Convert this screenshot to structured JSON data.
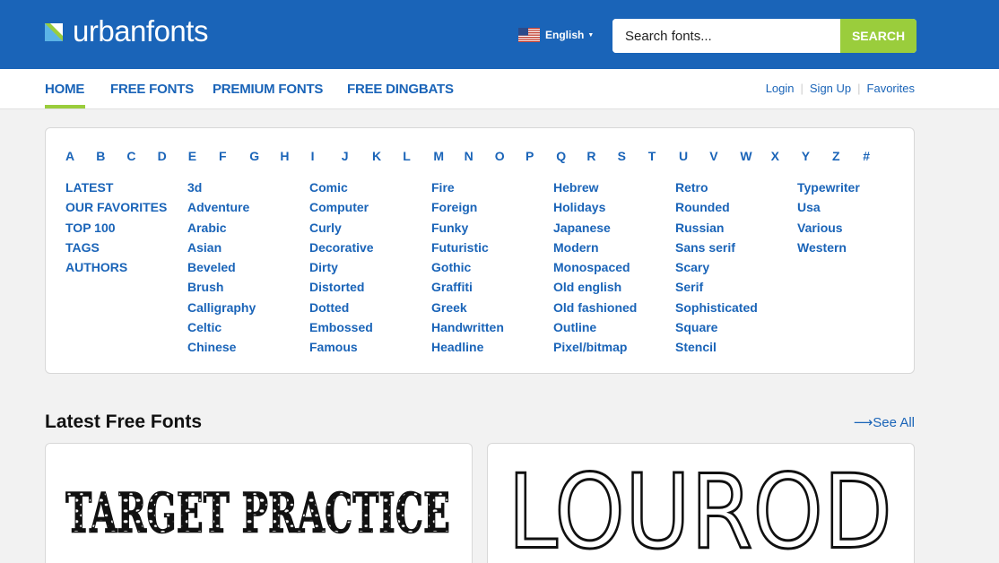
{
  "header": {
    "logo_text": "urbanfonts",
    "language": "English",
    "search": {
      "placeholder": "Search fonts...",
      "button_label": "SEARCH"
    },
    "brand_color": "#1a64b8",
    "accent_color": "#9acd3c"
  },
  "nav": {
    "items": [
      {
        "label": "HOME",
        "active": true
      },
      {
        "label": "FREE FONTS"
      },
      {
        "label": "PREMIUM FONTS"
      },
      {
        "label": "FREE DINGBATS"
      }
    ],
    "user_links": [
      "Login",
      "Sign Up",
      "Favorites"
    ]
  },
  "alphabet": [
    "A",
    "B",
    "C",
    "D",
    "E",
    "F",
    "G",
    "H",
    "I",
    "J",
    "K",
    "L",
    "M",
    "N",
    "O",
    "P",
    "Q",
    "R",
    "S",
    "T",
    "U",
    "V",
    "W",
    "X",
    "Y",
    "Z",
    "#"
  ],
  "categories": {
    "col1": [
      "LATEST",
      "OUR FAVORITES",
      "TOP 100",
      "TAGS",
      "AUTHORS"
    ],
    "col2": [
      "3d",
      "Adventure",
      "Arabic",
      "Asian",
      "Beveled",
      "Brush",
      "Calligraphy",
      "Celtic",
      "Chinese"
    ],
    "col3": [
      "Comic",
      "Computer",
      "Curly",
      "Decorative",
      "Dirty",
      "Distorted",
      "Dotted",
      "Embossed",
      "Famous"
    ],
    "col4": [
      "Fire",
      "Foreign",
      "Funky",
      "Futuristic",
      "Gothic",
      "Graffiti",
      "Greek",
      "Handwritten",
      "Headline"
    ],
    "col5": [
      "Hebrew",
      "Holidays",
      "Japanese",
      "Modern",
      "Monospaced",
      "Old english",
      "Old fashioned",
      "Outline",
      "Pixel/bitmap"
    ],
    "col6": [
      "Retro",
      "Rounded",
      "Russian",
      "Sans serif",
      "Scary",
      "Serif",
      "Sophisticated",
      "Square",
      "Stencil"
    ],
    "col7": [
      "Typewriter",
      "Usa",
      "Various",
      "Western"
    ]
  },
  "latest": {
    "title": "Latest Free Fonts",
    "see_all": "See All",
    "arrow": "⟶",
    "fonts": [
      "TARGET PRACTICE",
      "LOUROD"
    ]
  }
}
